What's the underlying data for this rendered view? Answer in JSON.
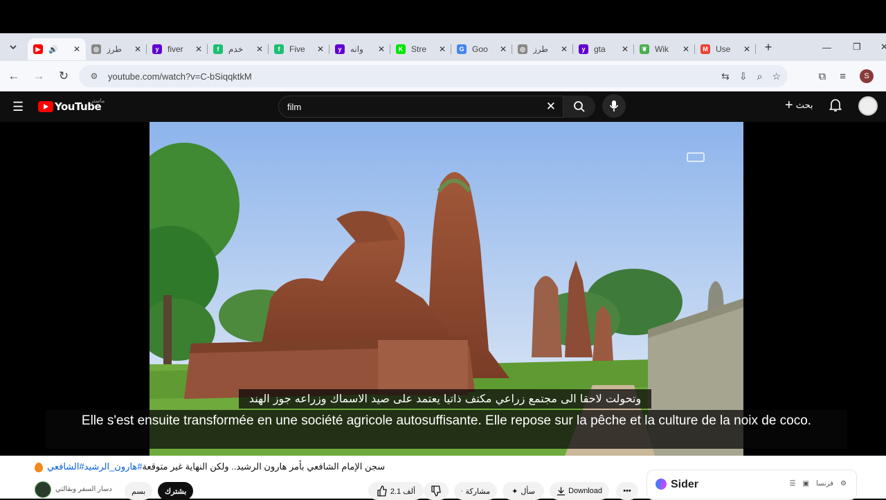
{
  "browser": {
    "tabs": [
      {
        "title": "",
        "favicon": "youtube-icon",
        "color": "#ff0000",
        "active": true
      },
      {
        "title": "طرز",
        "favicon": "globe-icon",
        "color": "#888888"
      },
      {
        "title": "fiver",
        "favicon": "yahoo-icon",
        "color": "#6001d2"
      },
      {
        "title": "خدم",
        "favicon": "fiverr-icon",
        "color": "#1dbf73"
      },
      {
        "title": "Five",
        "favicon": "fiverr-icon",
        "color": "#1dbf73"
      },
      {
        "title": "وانه",
        "favicon": "yahoo-icon",
        "color": "#6001d2"
      },
      {
        "title": "Stre",
        "favicon": "kick-icon",
        "color": "#00e701"
      },
      {
        "title": "Goo",
        "favicon": "google-icon",
        "color": "#4285f4"
      },
      {
        "title": "طرز",
        "favicon": "globe-icon",
        "color": "#888888"
      },
      {
        "title": "gta",
        "favicon": "yahoo-icon",
        "color": "#6001d2"
      },
      {
        "title": "Wik",
        "favicon": "leaf-icon",
        "color": "#4caf50"
      },
      {
        "title": "Use",
        "favicon": "gmail-icon",
        "color": "#ea4335"
      }
    ],
    "url": "youtube.com/watch?v=C-bSiqqktkM",
    "profile_initial": "S"
  },
  "youtube": {
    "region_code": "ماستر",
    "search_value": "film",
    "create_label": "بحث"
  },
  "video": {
    "subtitle_ar": "وتحولت لاحقا الى مجتمع زراعي مكتف ذاتيا يعتمد على صيد الاسماك وزراعه جوز الهند",
    "subtitle_fr": "Elle s'est ensuite transformée en une société agricole autosuffisante. Elle repose sur la pêche et la culture de la noix de coco."
  },
  "details": {
    "title_tags": "#هارون_الرشيد#الشافعي",
    "title_text": "سجن الإمام الشافعي بأمر هارون الرشيد.. ولكن النهاية غير متوقعة",
    "channel_name": "دسار السفر وبقالتي",
    "join_label": "بسم",
    "subscribe_label": "بشترك",
    "like_count": "2.1 ألف",
    "share_label": "مشاركة",
    "ask_label": "سأل",
    "download_label": "Download"
  },
  "sider": {
    "name": "Sider",
    "lang": "فرنسا"
  }
}
